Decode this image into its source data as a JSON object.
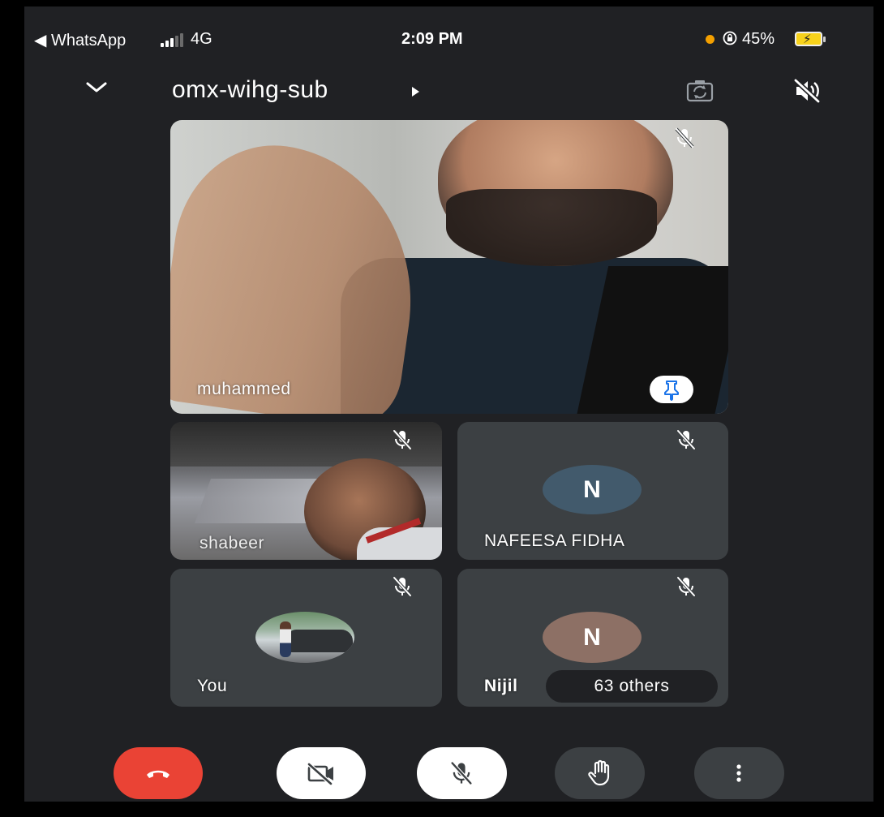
{
  "status_bar": {
    "back_app": "◀ WhatsApp",
    "network": "4G",
    "time": "2:09 PM",
    "lock_icon": "rotation-lock-icon",
    "battery_percent": "45%",
    "battery_level": 0.45,
    "recording_dot_color": "#f4a000"
  },
  "meeting": {
    "code": "omx-wihg-sub"
  },
  "participants": {
    "main": {
      "name": "muhammed",
      "muted": true,
      "pinned": true
    },
    "shabeer": {
      "name": "shabeer",
      "muted": true
    },
    "nafeesa": {
      "name": "NAFEESA FIDHA",
      "initial": "N",
      "muted": true,
      "avatar_color": "#425a6c"
    },
    "you": {
      "name": "You",
      "muted": true
    },
    "nijil": {
      "name": "Nijil",
      "initial": "N",
      "muted": true,
      "avatar_color": "#8d7065"
    },
    "others_label": "63 others"
  },
  "controls": {
    "end_call_color": "#ea4335",
    "icons": [
      "end-call-icon",
      "camera-off-icon",
      "mic-off-icon",
      "raise-hand-icon",
      "more-options-icon"
    ]
  }
}
